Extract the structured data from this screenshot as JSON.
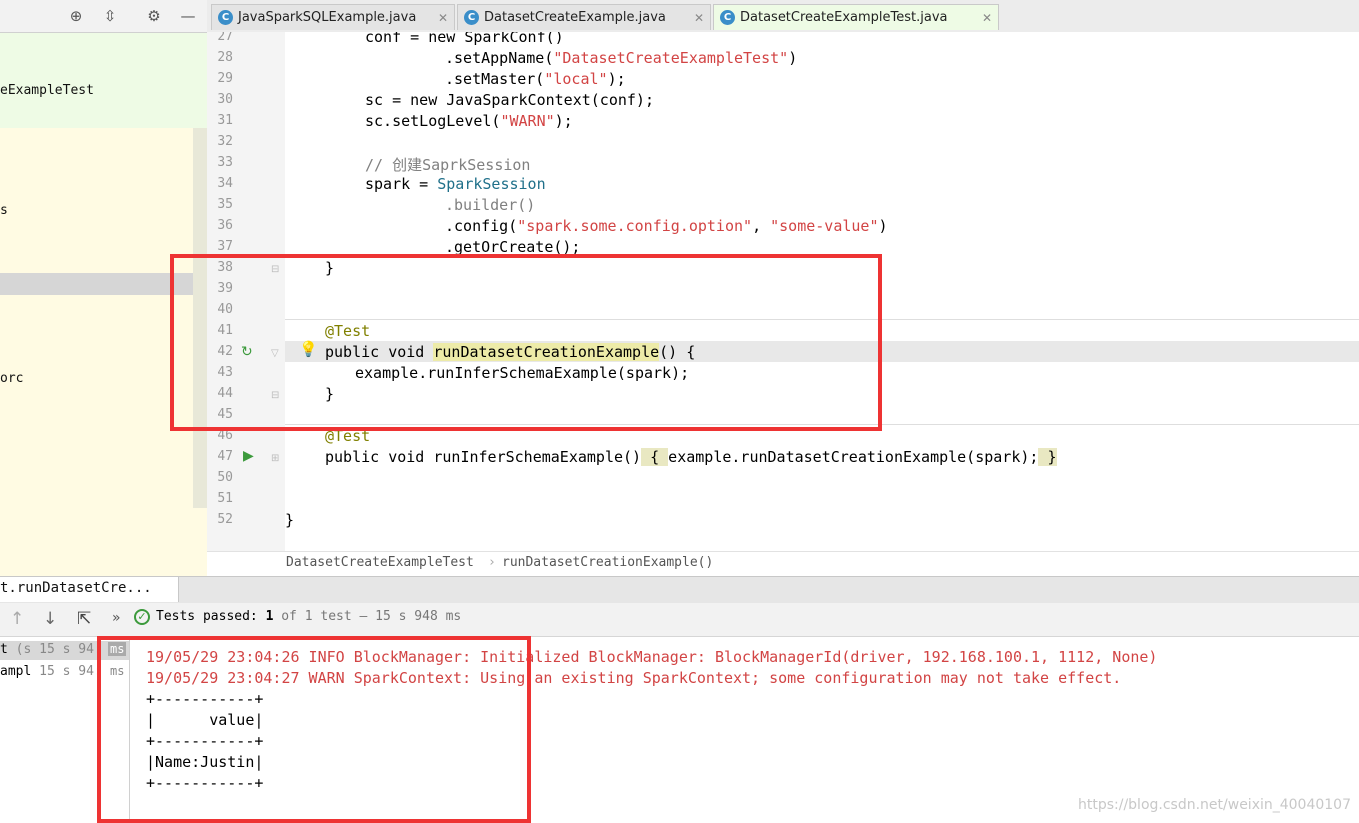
{
  "left_panel": {
    "tree_items": [
      "eExampleTest",
      "s",
      "orc"
    ]
  },
  "tabs": [
    {
      "label": "JavaSparkSQLExample.java",
      "icon": "c-class-icon"
    },
    {
      "label": "DatasetCreateExample.java",
      "icon": "c-class-icon"
    },
    {
      "label": "DatasetCreateExampleTest.java",
      "icon": "c-test-class-icon",
      "active": true
    }
  ],
  "editor": {
    "lines": [
      {
        "n": "27"
      },
      {
        "n": "28"
      },
      {
        "n": "29"
      },
      {
        "n": "30"
      },
      {
        "n": "31"
      },
      {
        "n": "32"
      },
      {
        "n": "33"
      },
      {
        "n": "34"
      },
      {
        "n": "35"
      },
      {
        "n": "36"
      },
      {
        "n": "37"
      },
      {
        "n": "38"
      },
      {
        "n": "39"
      },
      {
        "n": "40"
      },
      {
        "n": "41"
      },
      {
        "n": "42"
      },
      {
        "n": "43"
      },
      {
        "n": "44"
      },
      {
        "n": "45"
      },
      {
        "n": "46"
      },
      {
        "n": "47"
      },
      {
        "n": "50"
      },
      {
        "n": "51"
      },
      {
        "n": "52"
      }
    ],
    "code": {
      "l27": "conf = new SparkConf()",
      "l28a": ".setAppName(",
      "l28s": "\"DatasetCreateExampleTest\"",
      "l28b": ")",
      "l29a": ".setMaster(",
      "l29s": "\"local\"",
      "l29b": ");",
      "l30": "sc = new JavaSparkContext(conf);",
      "l31a": "sc.setLogLevel(",
      "l31s": "\"WARN\"",
      "l31b": ");",
      "l33": "// 创建SaprkSession",
      "l34a": "spark = ",
      "l34c": "SparkSession",
      "l35": ".builder()",
      "l36a": ".config(",
      "l36s1": "\"spark.some.config.option\"",
      "l36m": ", ",
      "l36s2": "\"some-value\"",
      "l36b": ")",
      "l37": ".getOrCreate();",
      "l38": "}",
      "l41": "@Test",
      "l42a": "public void ",
      "l42f": "runDatasetCreationExample",
      "l42b": "() {",
      "l43": "example.runInferSchemaExample(spark);",
      "l44": "}",
      "l46": "@Test",
      "l47a": "public void runInferSchemaExample()",
      "l47b": " { ",
      "l47c": "example.runDatasetCreationExample(spark);",
      "l47d": " }",
      "l52": "}"
    }
  },
  "breadcrumb": {
    "class": "DatasetCreateExampleTest",
    "sep": "›",
    "method": "runDatasetCreationExample()"
  },
  "run_panel": {
    "tab_label": "t.runDatasetCre...",
    "status_prefix": "Tests passed: ",
    "status_count": "1",
    "status_rest": " of 1 test – 15 s 948 ms",
    "tree": [
      {
        "name": "t",
        "time": "(s 15 s 94:"
      },
      {
        "name": "ampl",
        "time": "15 s 94:"
      }
    ],
    "tree_ms": [
      "ms",
      "ms"
    ],
    "console": [
      {
        "text": "19/05/29 23:04:26 INFO BlockManager: Initialized BlockManager: BlockManagerId(driver, 192.168.100.1, 1112, None)",
        "err": true
      },
      {
        "text": "19/05/29 23:04:27 WARN SparkContext: Using an existing SparkContext; some configuration may not take effect.",
        "err": true
      },
      {
        "text": "+-----------+",
        "err": false
      },
      {
        "text": "|      value|",
        "err": false
      },
      {
        "text": "+-----------+",
        "err": false
      },
      {
        "text": "|Name:Justin|",
        "err": false
      },
      {
        "text": "+-----------+",
        "err": false
      }
    ]
  },
  "watermark": "https://blog.csdn.net/weixin_40040107",
  "colors": {
    "string": "#d24444",
    "annotation": "#808000",
    "highlight_box": "#ee3333"
  }
}
